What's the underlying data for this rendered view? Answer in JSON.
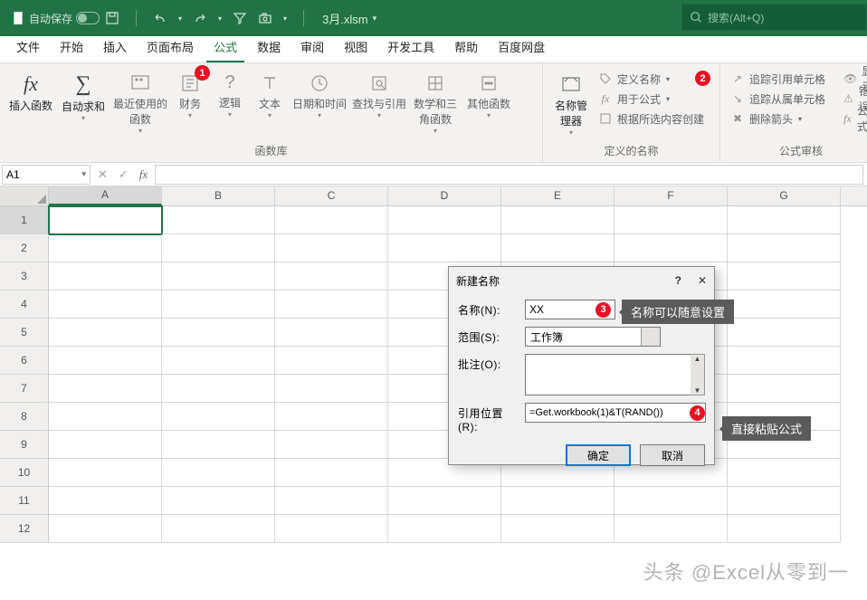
{
  "titlebar": {
    "autosave_label": "自动保存",
    "filename": "3月.xlsm",
    "search_placeholder": "搜索(Alt+Q)"
  },
  "tabs": [
    "文件",
    "开始",
    "插入",
    "页面布局",
    "公式",
    "数据",
    "审阅",
    "视图",
    "开发工具",
    "帮助",
    "百度网盘"
  ],
  "active_tab_index": 4,
  "ribbon": {
    "group_lib": "函数库",
    "group_names": "定义的名称",
    "group_audit": "公式审核",
    "insert_fn": "插入函数",
    "autosum": "自动求和",
    "recent": "最近使用的函数",
    "finance": "财务",
    "logic": "逻辑",
    "text": "文本",
    "datetime": "日期和时间",
    "lookup": "查找与引用",
    "math": "数学和三角函数",
    "more": "其他函数",
    "name_mgr": "名称管理器",
    "define_name": "定义名称",
    "use_in_formula": "用于公式",
    "create_from_sel": "根据所选内容创建",
    "trace_prec": "追踪引用单元格",
    "trace_dep": "追踪从属单元格",
    "remove_arrows": "删除箭头",
    "show": "显示",
    "error": "错误",
    "formula": "公式"
  },
  "badges": {
    "b1": "1",
    "b2": "2"
  },
  "namebox": "A1",
  "columns": [
    "A",
    "B",
    "C",
    "D",
    "E",
    "F",
    "G"
  ],
  "rows": [
    "1",
    "2",
    "3",
    "4",
    "5",
    "6",
    "7",
    "8",
    "9",
    "10",
    "11",
    "12"
  ],
  "dialog": {
    "title": "新建名称",
    "help": "?",
    "lbl_name": "名称(N):",
    "lbl_scope": "范围(S):",
    "lbl_comment": "批注(O):",
    "lbl_ref": "引用位置(R):",
    "name_value": "XX",
    "scope_value": "工作簿",
    "ref_value": "=Get.workbook(1)&T(RAND())",
    "ok": "确定",
    "cancel": "取消",
    "dot3": "3",
    "dot4": "4"
  },
  "callouts": {
    "c3": "名称可以随意设置",
    "c4": "直接粘贴公式"
  },
  "watermark": "头条 @Excel从零到一"
}
